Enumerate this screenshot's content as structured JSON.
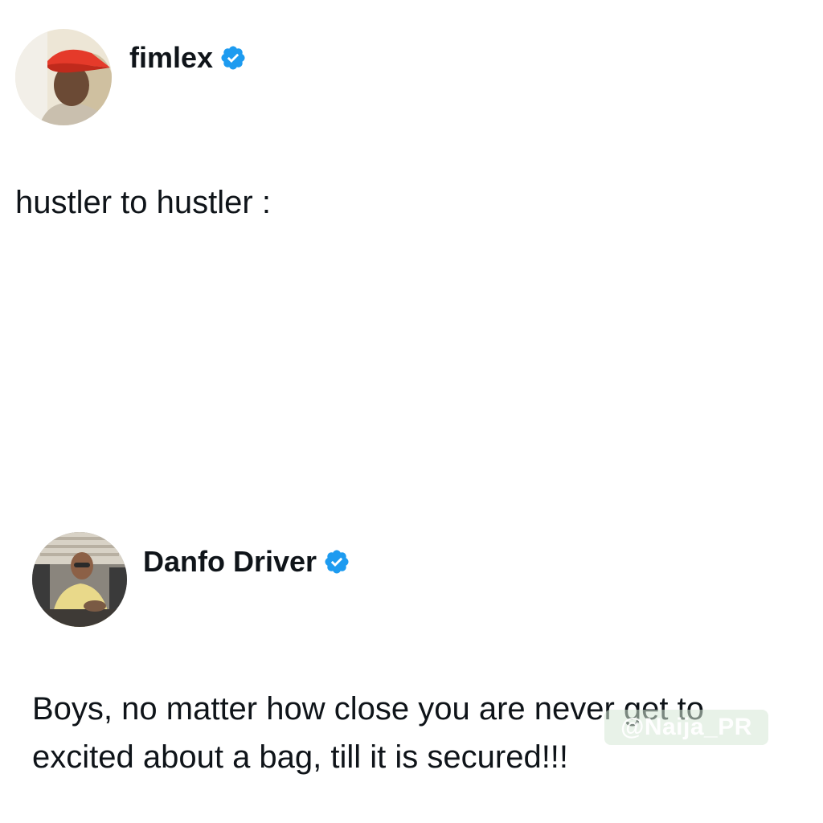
{
  "main_tweet": {
    "author": {
      "name": "fimlex",
      "verified": true,
      "avatar_icon": "avatar-red-cap"
    },
    "text": "hustler to hustler :"
  },
  "quoted_tweet": {
    "author": {
      "name": "Danfo Driver",
      "verified": true,
      "avatar_icon": "avatar-man-at-desk"
    },
    "text_lines": [
      "Boys, no matter how close you are never get to",
      "excited about a bag, till it is secured!!!"
    ]
  },
  "watermark": "@Naija_PR",
  "colors": {
    "verified_badge": "#1d9bf0",
    "text": "#0f1419",
    "background": "#ffffff"
  }
}
